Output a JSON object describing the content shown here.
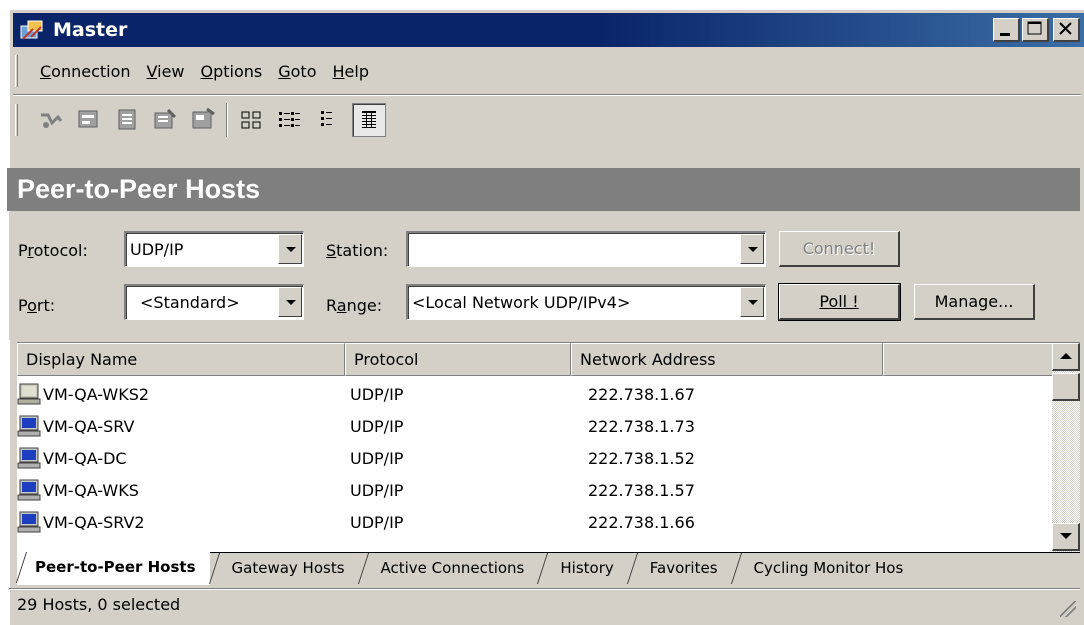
{
  "window": {
    "title": "Master"
  },
  "menu": [
    {
      "pre": "",
      "key": "C",
      "post": "onnection"
    },
    {
      "pre": "",
      "key": "V",
      "post": "iew"
    },
    {
      "pre": "",
      "key": "O",
      "post": "ptions"
    },
    {
      "pre": "",
      "key": "G",
      "post": "oto"
    },
    {
      "pre": "",
      "key": "H",
      "post": "elp"
    }
  ],
  "banner": {
    "title": "Peer-to-Peer Hosts"
  },
  "form": {
    "protocol_label_pre": "P",
    "protocol_label_key": "r",
    "protocol_label_post": "otocol:",
    "protocol_value": "UDP/IP",
    "port_label_pre": "P",
    "port_label_key": "o",
    "port_label_post": "rt:",
    "port_value": "<Standard>",
    "station_label_pre": "",
    "station_label_key": "S",
    "station_label_post": "tation:",
    "station_value": "",
    "range_label_pre": "R",
    "range_label_key": "a",
    "range_label_post": "nge:",
    "range_value": "<Local Network UDP/IPv4>",
    "connect_label": "Connect!",
    "poll_label": "Poll  !",
    "manage_label": "Manage..."
  },
  "table": {
    "columns": [
      "Display Name",
      "Protocol",
      "Network Address",
      ""
    ],
    "rows": [
      {
        "name": "VM-QA-WKS2",
        "protocol": "UDP/IP",
        "address": "222.738.1.67",
        "icon": "computer-gray-icon"
      },
      {
        "name": "VM-QA-SRV",
        "protocol": "UDP/IP",
        "address": "222.738.1.73",
        "icon": "computer-blue-icon"
      },
      {
        "name": "VM-QA-DC",
        "protocol": "UDP/IP",
        "address": "222.738.1.52",
        "icon": "computer-blue-icon"
      },
      {
        "name": "VM-QA-WKS",
        "protocol": "UDP/IP",
        "address": "222.738.1.57",
        "icon": "computer-blue-icon"
      },
      {
        "name": "VM-QA-SRV2",
        "protocol": "UDP/IP",
        "address": "222.738.1.66",
        "icon": "computer-blue-icon"
      }
    ]
  },
  "tabs": [
    "Peer-to-Peer Hosts",
    "Gateway Hosts",
    "Active Connections",
    "History",
    "Favorites",
    "Cycling Monitor Hos"
  ],
  "status": {
    "text": "29 Hosts, 0 selected"
  },
  "colors": {
    "titlebar": "#0a246a",
    "banner": "#7f7f7f",
    "face": "#d4d0c8"
  }
}
